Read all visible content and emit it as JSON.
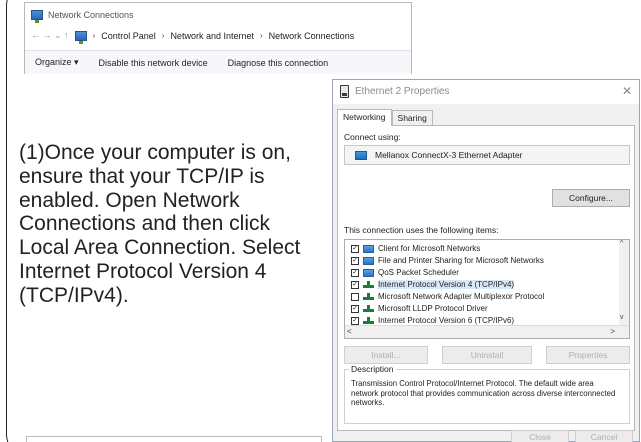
{
  "network_connections": {
    "title": "Network Connections",
    "address": {
      "nav_symbols": "←  →  ⌄  ↑",
      "sep": "›",
      "crumbs": [
        "Control Panel",
        "Network and Internet",
        "Network Connections"
      ]
    },
    "toolbar": {
      "organize": "Organize ▾",
      "disable": "Disable this network device",
      "diagnose": "Diagnose this connection"
    }
  },
  "dialog": {
    "title": "Ethernet 2 Properties",
    "close": "✕",
    "tabs": [
      {
        "label": "Networking",
        "active": true
      },
      {
        "label": "Sharing",
        "active": false
      }
    ],
    "connect_using_label": "Connect using:",
    "adapter_name": "Mellanox ConnectX-3 Ethernet Adapter",
    "configure_button": "Configure...",
    "items_label": "This connection uses the following items:",
    "items": [
      {
        "checked": true,
        "icon": "client-icon",
        "label": "Client for Microsoft Networks"
      },
      {
        "checked": true,
        "icon": "client-icon",
        "label": "File and Printer Sharing for Microsoft Networks"
      },
      {
        "checked": true,
        "icon": "client-icon",
        "label": "QoS Packet Scheduler"
      },
      {
        "checked": true,
        "icon": "protocol-icon",
        "label": "Internet Protocol Version 4 (TCP/IPv4)",
        "selected": true
      },
      {
        "checked": false,
        "icon": "protocol-icon",
        "label": "Microsoft Network Adapter Multiplexor Protocol"
      },
      {
        "checked": true,
        "icon": "protocol-icon",
        "label": "Microsoft LLDP Protocol Driver"
      },
      {
        "checked": true,
        "icon": "protocol-icon",
        "label": "Internet Protocol Version 6 (TCP/IPv6)"
      }
    ],
    "scroll": {
      "up": "^",
      "down": "v",
      "left": "<",
      "right": ">"
    },
    "buttons": {
      "install": "Install...",
      "uninstall": "Uninstall",
      "properties": "Properties"
    },
    "description_legend": "Description",
    "description_text": "Transmission Control Protocol/Internet Protocol. The default wide area network protocol that provides communication across diverse interconnected networks.",
    "footer": {
      "close": "Close",
      "cancel": "Cancel"
    }
  },
  "instruction_text": "(1)Once your computer is on, ensure that your TCP/IP is enabled. Open Network Connections and then click Local Area Connection. Select Internet Protocol Version 4 (TCP/IPv4)."
}
